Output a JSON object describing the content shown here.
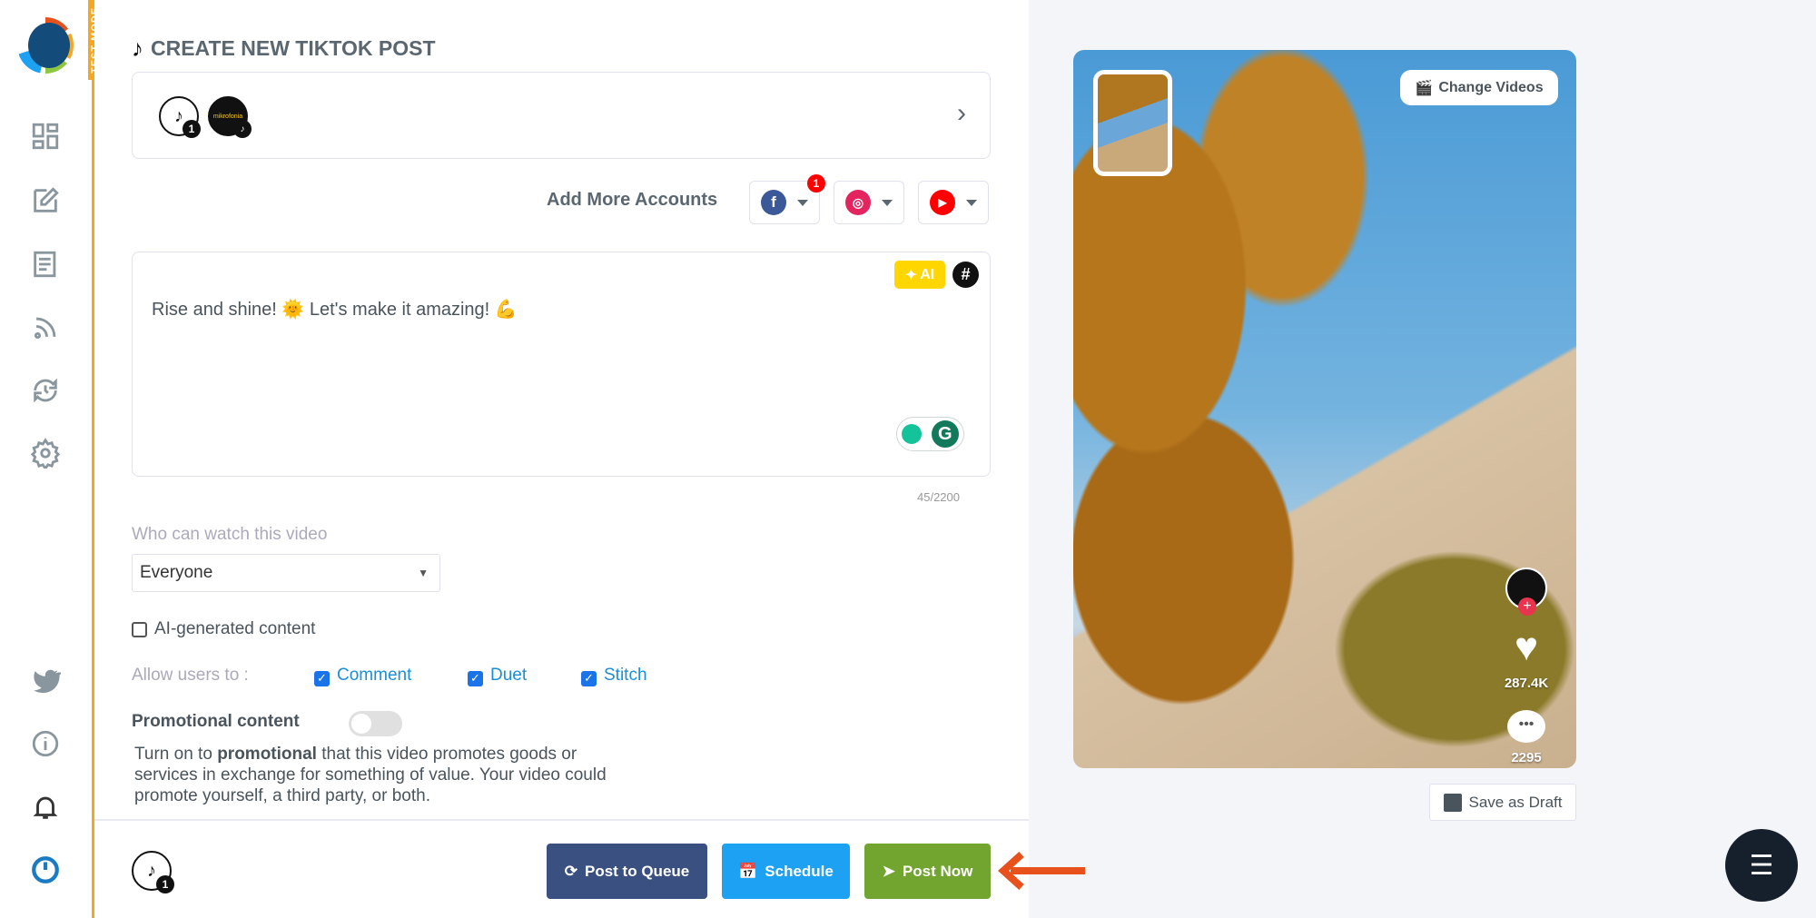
{
  "app": {
    "test_mode_label": "TEST MODE"
  },
  "sidebar": {
    "top_items": [
      {
        "icon": "dashboard-icon"
      },
      {
        "icon": "compose-icon"
      },
      {
        "icon": "posts-icon"
      },
      {
        "icon": "rss-feed-icon"
      },
      {
        "icon": "recycle-schedule-icon"
      },
      {
        "icon": "settings-icon"
      }
    ],
    "bottom_items": [
      {
        "icon": "twitter-icon"
      },
      {
        "icon": "info-icon"
      },
      {
        "icon": "bell-icon"
      },
      {
        "icon": "power-icon"
      }
    ]
  },
  "header": {
    "title": "CREATE NEW TIKTOK POST"
  },
  "accounts": {
    "selected_count": "1",
    "avatar_label": "mikrofonia"
  },
  "add_more": {
    "label": "Add More Accounts",
    "facebook_badge": "1"
  },
  "editor": {
    "text": "Rise and shine! 🌞  Let's make it amazing! 💪",
    "ai_label": "AI",
    "hashtag_label": "#",
    "char_count": "45/2200"
  },
  "privacy": {
    "label": "Who can watch this video",
    "value": "Everyone"
  },
  "ai_generated": {
    "label": "AI-generated content",
    "checked": false
  },
  "allow": {
    "label": "Allow users to :",
    "options": [
      {
        "label": "Comment",
        "checked": true
      },
      {
        "label": "Duet",
        "checked": true
      },
      {
        "label": "Stitch",
        "checked": true
      }
    ]
  },
  "promotional": {
    "label": "Promotional content",
    "enabled": false,
    "desc_pre": "Turn on to ",
    "desc_bold": "promotional",
    "desc_post": " that this video promotes goods or services in exchange for something of value. Your video could promote yourself, a third party, or both."
  },
  "footer": {
    "account_count": "1",
    "post_queue": "Post to Queue",
    "schedule": "Schedule",
    "post_now": "Post Now"
  },
  "preview": {
    "change_videos": "Change Videos",
    "likes": "287.4K",
    "comments": "2295",
    "save_draft": "Save as Draft"
  },
  "colors": {
    "accent_orange": "#f5a623",
    "queue": "#3a5080",
    "schedule": "#1da1f2",
    "post_now": "#72a52f",
    "arrow": "#e8501c"
  }
}
